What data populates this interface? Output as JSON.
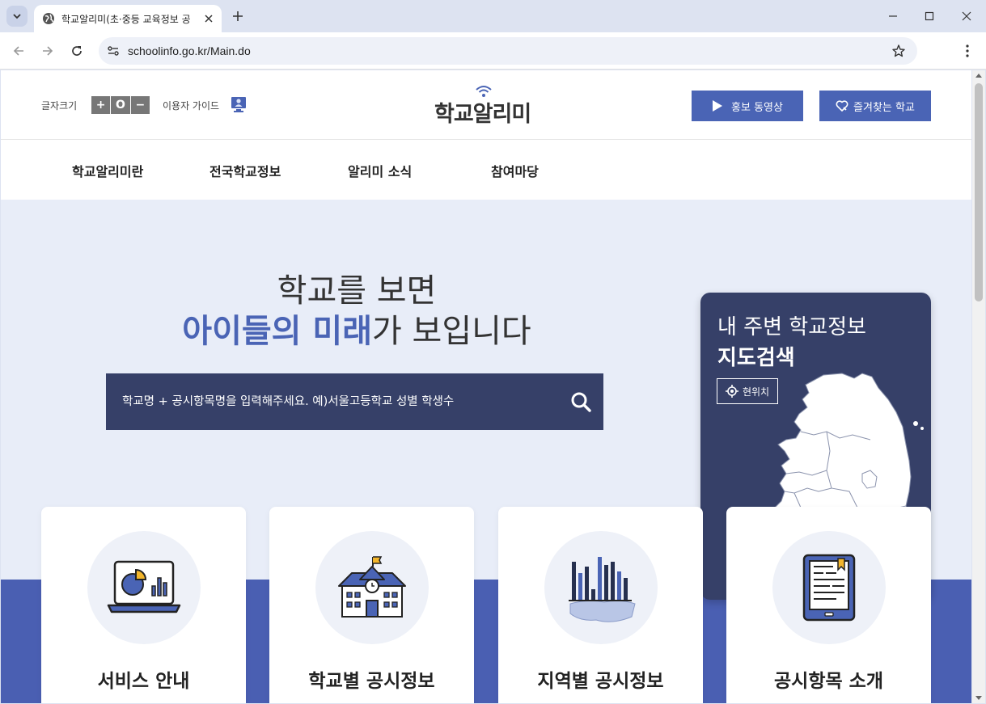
{
  "browser": {
    "tab_title": "학교알리미(초·중등 교육정보 공",
    "url": "schoolinfo.go.kr/Main.do"
  },
  "header": {
    "font_size_label": "글자크기",
    "font_controls": [
      "+",
      "O",
      "−"
    ],
    "user_guide_label": "이용자 가이드",
    "logo_text": "학교알리미",
    "promo_video_button": "홍보 동영상",
    "favorites_button": "즐겨찾는 학교"
  },
  "nav": {
    "items": [
      "학교알리미란",
      "전국학교정보",
      "알리미 소식",
      "참여마당"
    ]
  },
  "hero": {
    "title_line1": "학교를 보면",
    "title_highlight": "아이들의 미래",
    "title_rest": "가 보입니다",
    "search_placeholder": "학교명 + 공시항목명을 입력해주세요. 예)서울고등학교 성별 학생수"
  },
  "map_card": {
    "line1": "내 주변 학교정보",
    "line2": "지도검색",
    "location_button": "현위치"
  },
  "cards": [
    {
      "label": "서비스 안내",
      "icon": "laptop-chart-icon"
    },
    {
      "label": "학교별 공시정보",
      "icon": "school-building-icon"
    },
    {
      "label": "지역별 공시정보",
      "icon": "regional-bar-chart-icon"
    },
    {
      "label": "공시항목 소개",
      "icon": "tablet-document-icon"
    }
  ],
  "colors": {
    "primary": "#4a64b5",
    "dark_navy": "#364068",
    "hero_bg": "#e8edf8",
    "band": "#4a5fb2"
  }
}
